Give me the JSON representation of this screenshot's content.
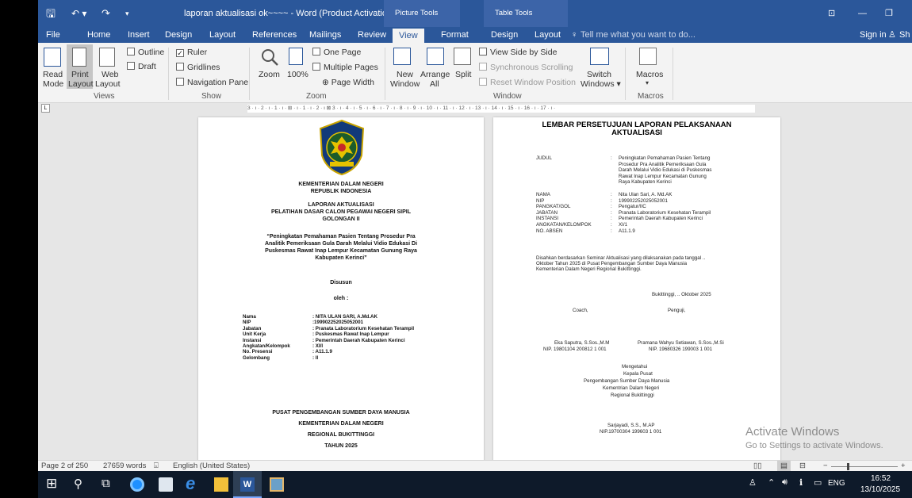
{
  "titlebar": {
    "quick_save": "🖫",
    "quick_undo": "↶ ▾",
    "quick_redo": "↷",
    "quick_more": "▾",
    "title": "laporan aktualisasi ok~~~~ - Word (Product Activation Failed)",
    "context_picture": "Picture Tools",
    "context_table": "Table Tools",
    "ribbon_display": "⊡",
    "minimize": "—",
    "restore": "❐"
  },
  "tabs": {
    "file": "File",
    "home": "Home",
    "insert": "Insert",
    "design": "Design",
    "layout": "Layout",
    "references": "References",
    "mailings": "Mailings",
    "review": "Review",
    "view": "View",
    "format": "Format",
    "table_design": "Design",
    "table_layout": "Layout",
    "tell_me": "Tell me what you want to do...",
    "sign_in": "Sign in",
    "share": "Sh"
  },
  "ribbon": {
    "views": {
      "label": "Views",
      "read_mode": "Read\nMode",
      "read": "Read",
      "mode": "Mode",
      "print": "Print",
      "print_layout": "Layout",
      "web": "Web",
      "web_layout": "Layout",
      "outline": "Outline",
      "draft": "Draft"
    },
    "show": {
      "label": "Show",
      "ruler": "Ruler",
      "gridlines": "Gridlines",
      "nav_pane": "Navigation Pane"
    },
    "zoom": {
      "label": "Zoom",
      "zoom": "Zoom",
      "hundred": "100%",
      "one_page": "One Page",
      "multiple_pages": "Multiple Pages",
      "page_width": "Page Width"
    },
    "window": {
      "label": "Window",
      "new": "New",
      "new_window": "Window",
      "arrange": "Arrange",
      "arrange_all": "All",
      "split": "Split",
      "side_by_side": "View Side by Side",
      "sync_scroll": "Synchronous Scrolling",
      "reset_pos": "Reset Window Position",
      "switch": "Switch",
      "switch_windows": "Windows ▾"
    },
    "macros": {
      "label": "Macros",
      "macros": "Macros",
      "macros_arrow": "▾"
    }
  },
  "ruler": {
    "corner": "L",
    "text": "3 · ı · 2 · ı · 1 · ı · ⊞ · ı · 1 · ı · 2 · ı ⊠ 3 · ı · 4 · ı · 5 · ı · 6 · ı · 7 · ı · 8 · ı · 9 · ı · 10 · ı · 11 · ı · 12 · ı · 13 · ı · 14 · ı · 15 · ı · 16 · ı · 17 · ı ·"
  },
  "page1": {
    "ministry1": "KEMENTERIAN DALAM NEGERI",
    "ministry2": "REPUBLIK INDONESIA",
    "report1": "LAPORAN AKTUALISASI",
    "report2": "PELATIHAN DASAR CALON PEGAWAI NEGERI SIPIL",
    "report3": "GOLONGAN II",
    "topic1": "“Peningkatan Pemahaman Pasien Tentang Prosedur Pra",
    "topic2": "Analitik Pemeriksaan Gula Darah Melalui Vidio Edukasi Di",
    "topic3": "Puskesmas Rawat Inap Lempur Kecamatan Gunung Raya",
    "topic4": "Kabupaten Kerinci”",
    "disusun": "Disusun",
    "oleh": "oleh :",
    "info": [
      {
        "k": "Nama",
        "v": ": NITA ULAN SARI, A.Md.AK"
      },
      {
        "k": "NIP",
        "v": ":199902252025052001"
      },
      {
        "k": "Jabatan",
        "v": ": Pranata Laboratorium Kesehatan Terampil"
      },
      {
        "k": "Unit Kerja",
        "v": ": Puskesmas Rawat Inap Lempur"
      },
      {
        "k": "Instansi",
        "v": ": Pemerintah Daerah Kabupaten Kerinci"
      },
      {
        "k": "Angkatan/Kelompok",
        "v": ": XI/I"
      },
      {
        "k": "No. Presensi",
        "v": ": A11.1.9"
      },
      {
        "k": "Gelombang",
        "v": ": II"
      }
    ],
    "footer1": "PUSAT PENGEMBANGAN SUMBER DAYA MANUSIA",
    "footer2": "KEMENTERIAN DALAM NEGERI",
    "footer3": "REGIONAL BUKITTINGGI",
    "footer4": "TAHUN 2025"
  },
  "page2": {
    "heading1": "LEMBAR PERSETUJUAN LAPORAN PELAKSANAAN",
    "heading2": "AKTUALISASI",
    "judul_label": "JUDUL",
    "judul_lines": [
      "Peningkatan Pemahaman Pasien Tentang",
      "Prosedur Pra Analitik Pemeriksaan Gula",
      "Darah Melalui Vidio Edukasi di Puskesmas",
      "Rawat Inap Lempur Kecamatan Gunung",
      "Raya Kabupaten Kerinci"
    ],
    "fields": [
      {
        "k": "NAMA",
        "v": "Nita Ulan Sari, A. Md.AK"
      },
      {
        "k": "NIP",
        "v": "199902252025052001"
      },
      {
        "k": "PANGKAT/GOL",
        "v": "Pengatur/IIC"
      },
      {
        "k": "JABATAN",
        "v": "Pranata Laboratorium Kesehatan Terampil"
      },
      {
        "k": "INSTANSI",
        "v": "Pemerintah Daerah Kabupaten Kerinci"
      },
      {
        "k": "ANGKATAN/KELOMPOK",
        "v": "XI/1"
      },
      {
        "k": "NO. ABSEN",
        "v": "A11.1.9"
      }
    ],
    "para1": "Disahkan berdasarkan Seminar Aktualisasi yang dilaksanakan pada tanggal ..",
    "para2": "Oktober  Tahun  2025  di  Pusat  Pengembangan  Sumber  Daya  Manusia",
    "para3": "Kementerian Dalam Negeri Regional Bukittinggi.",
    "place_date": "Bukittinggi,  ..  Oktober 2025",
    "coach": "Coach,",
    "penguji": "Penguji,",
    "coach_name": "Eka Saputra, S.Sos.,M.M",
    "coach_nip": "NIP. 19801104 200812 1 001",
    "penguji_name": "Pramana Wahyu Setiawan, S.Sos.,M.Si",
    "penguji_nip": "NIP. 19680326 199003 1 001",
    "mengetahui": "Mengetahui",
    "kepala": "Kepala Pusat",
    "pengembangan": "Pengembangan Sumber Daya Manusia",
    "kementrian": "Kementrian Dalam Negeri",
    "regional": "Regional Bukittinggi",
    "head_name": "Sarjayadi, S.S., M.AP",
    "head_nip": "NIP.19700304 199603 1 001"
  },
  "watermark": {
    "line1": "Activate Windows",
    "line2": "Go to Settings to activate Windows."
  },
  "statusbar": {
    "page": "Page 2 of 250",
    "words": "27659 words",
    "proof": "⌺",
    "language": "English (United States)",
    "minus": "−",
    "plus": "+"
  },
  "taskbar": {
    "start": "⊞",
    "search": "⚲",
    "taskview": "⧉",
    "word_label": "W",
    "tray_person": "♙",
    "tray_arrow": "⌃",
    "tray_vol": "🔊︎",
    "tray_net": "ℹ",
    "tray_bat": "▭",
    "lang": "ENG",
    "time": "16:52",
    "date": "13/10/2025"
  },
  "colors": {
    "word_blue": "#2b579a",
    "taskbar": "#0e1a2a"
  }
}
